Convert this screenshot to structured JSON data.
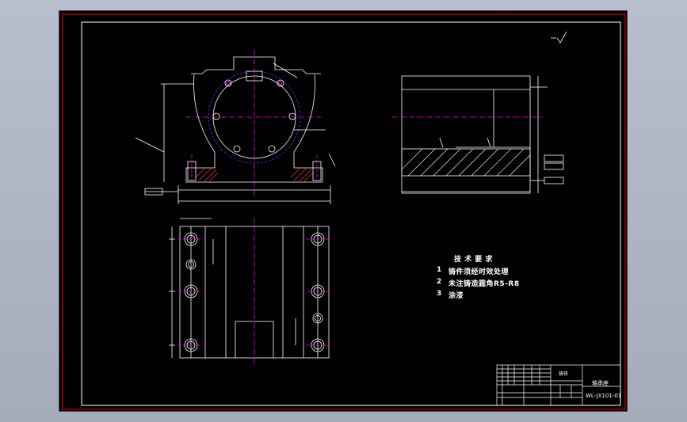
{
  "technical_requirements": {
    "heading": "技 术 要 求",
    "items": [
      {
        "num": "1",
        "text": "铸件须经时效处理"
      },
      {
        "num": "2",
        "text": "未注铸造圆角R5-R8"
      },
      {
        "num": "3",
        "text": "涂漆"
      }
    ]
  },
  "title_block": {
    "material": "铸铁",
    "part_name": "轴承座",
    "drawing_number": "WL-JX101-01"
  },
  "colors": {
    "background": "#000000",
    "frame": "#ffffff",
    "border_red": "#ff0000",
    "centerline": "#ff00ff",
    "dimension": "#ffffff",
    "hidden_circle": "#3b3bff",
    "hatch": "#ff3333"
  }
}
